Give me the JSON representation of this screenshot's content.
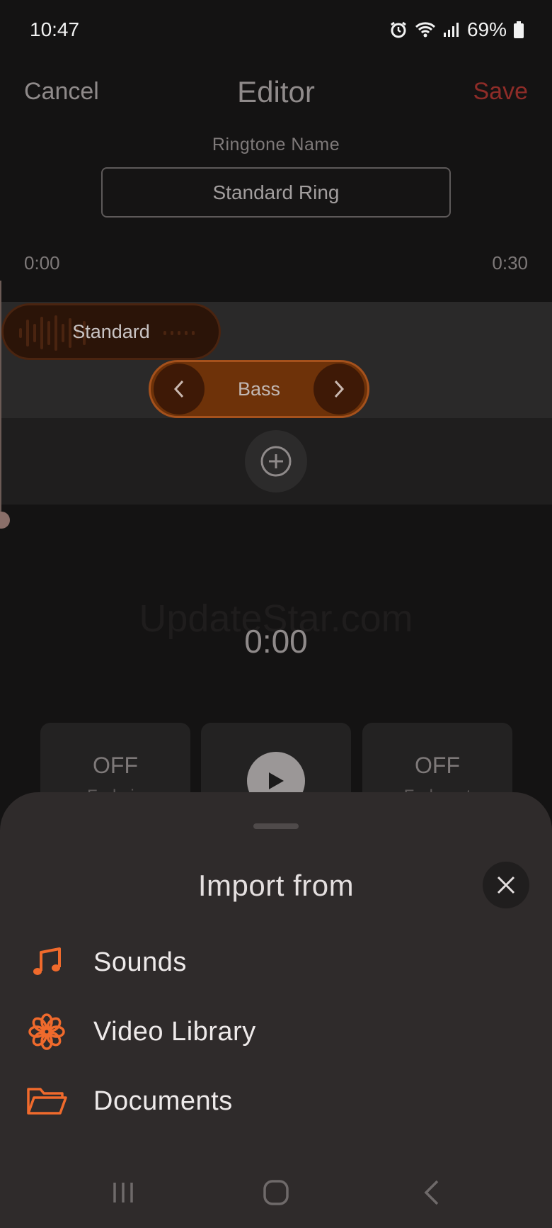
{
  "status_bar": {
    "time": "10:47",
    "battery": "69%"
  },
  "header": {
    "cancel_label": "Cancel",
    "title": "Editor",
    "save_label": "Save"
  },
  "ringtone": {
    "name_label": "Ringtone Name",
    "name_value": "Standard Ring"
  },
  "timeline": {
    "start": "0:00",
    "end": "0:30"
  },
  "tracks": [
    {
      "label": "Standard"
    },
    {
      "label": "Bass"
    }
  ],
  "watermark": "UpdateStar.com",
  "playback": {
    "time": "0:00"
  },
  "controls": [
    {
      "state": "OFF",
      "label": "Fade in"
    },
    {
      "state": "OFF",
      "label": "Fade out"
    }
  ],
  "import_sheet": {
    "title": "Import from",
    "options": [
      {
        "label": "Sounds",
        "icon": "music-note-icon"
      },
      {
        "label": "Video Library",
        "icon": "flower-icon"
      },
      {
        "label": "Documents",
        "icon": "folder-icon"
      }
    ]
  },
  "colors": {
    "accent": "#f06a2c",
    "save": "#8e2c28",
    "sheet_bg": "#2f2b2b"
  }
}
